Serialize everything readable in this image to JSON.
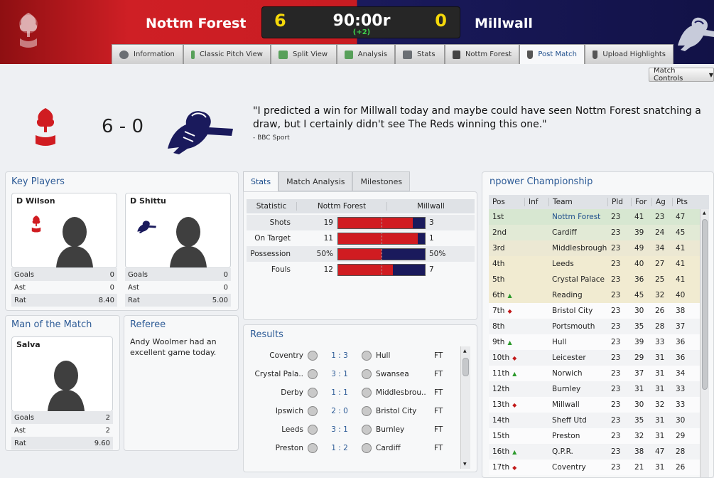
{
  "header": {
    "home_team": "Nottm Forest",
    "away_team": "Millwall",
    "home_score": "6",
    "away_score": "0",
    "clock": "90:00r",
    "added_time": "(+2)"
  },
  "tabs": [
    {
      "label": "Information",
      "icon": "info-icon"
    },
    {
      "label": "Classic Pitch View",
      "icon": "pitch-icon"
    },
    {
      "label": "Split View",
      "icon": "split-view-icon"
    },
    {
      "label": "Analysis",
      "icon": "analysis-icon"
    },
    {
      "label": "Stats",
      "icon": "stats-icon"
    },
    {
      "label": "Nottm Forest",
      "icon": "team-icon"
    },
    {
      "label": "Post Match",
      "icon": "shield-icon",
      "active": true
    },
    {
      "label": "Upload Highlights",
      "icon": "upload-icon"
    }
  ],
  "match_controls": "Match Controls",
  "summary": {
    "score": "6 - 0",
    "quote": "\"I predicted a win for Millwall today and maybe could have seen Nottm Forest snatching a draw, but I certainly didn't see The Reds winning this one.\"",
    "source": "- BBC Sport"
  },
  "key_players": {
    "title": "Key Players",
    "players": [
      {
        "name": "D Wilson",
        "goals": "0",
        "ast": "0",
        "rat": "8.40"
      },
      {
        "name": "D Shittu",
        "goals": "0",
        "ast": "0",
        "rat": "5.00"
      }
    ],
    "labels": {
      "goals": "Goals",
      "ast": "Ast",
      "rat": "Rat"
    }
  },
  "motm": {
    "title": "Man of the Match",
    "name": "Salva",
    "goals": "2",
    "ast": "2",
    "rat": "9.60"
  },
  "referee": {
    "title": "Referee",
    "text": "Andy Woolmer had an excellent game today."
  },
  "stats_tabs": [
    "Stats",
    "Match Analysis",
    "Milestones"
  ],
  "stats": {
    "headers": [
      "Statistic",
      "Nottm Forest",
      "Millwall"
    ],
    "rows": [
      {
        "label": "Shots",
        "home": "19",
        "away": "3",
        "share": 0.86
      },
      {
        "label": "On Target",
        "home": "11",
        "away": "1",
        "share": 0.92
      },
      {
        "label": "Possession",
        "home": "50%",
        "away": "50%",
        "share": 0.5
      },
      {
        "label": "Fouls",
        "home": "12",
        "away": "7",
        "share": 0.63
      }
    ]
  },
  "results": {
    "title": "Results",
    "rows": [
      {
        "home": "Coventry",
        "score": "1 : 3",
        "away": "Hull",
        "status": "FT"
      },
      {
        "home": "Crystal Pala..",
        "score": "3 : 1",
        "away": "Swansea",
        "status": "FT"
      },
      {
        "home": "Derby",
        "score": "1 : 1",
        "away": "Middlesbrou..",
        "status": "FT"
      },
      {
        "home": "Ipswich",
        "score": "2 : 0",
        "away": "Bristol City",
        "status": "FT"
      },
      {
        "home": "Leeds",
        "score": "3 : 1",
        "away": "Burnley",
        "status": "FT"
      },
      {
        "home": "Preston",
        "score": "1 : 2",
        "away": "Cardiff",
        "status": "FT"
      }
    ]
  },
  "league": {
    "title": "npower Championship",
    "headers": [
      "Pos",
      "Inf",
      "Team",
      "Pld",
      "For",
      "Ag",
      "Pts"
    ],
    "rows": [
      {
        "pos": "1st",
        "move": "",
        "team": "Nottm Forest",
        "pld": "23",
        "for": "41",
        "ag": "23",
        "pts": "47",
        "zone": "#d7e7d1",
        "highlight": true
      },
      {
        "pos": "2nd",
        "move": "",
        "team": "Cardiff",
        "pld": "23",
        "for": "39",
        "ag": "24",
        "pts": "45",
        "zone": "#e2ead6"
      },
      {
        "pos": "3rd",
        "move": "",
        "team": "Middlesbrough",
        "pld": "23",
        "for": "49",
        "ag": "34",
        "pts": "41",
        "zone": "#ece8d3"
      },
      {
        "pos": "4th",
        "move": "",
        "team": "Leeds",
        "pld": "23",
        "for": "40",
        "ag": "27",
        "pts": "41",
        "zone": "#f1ebd1"
      },
      {
        "pos": "5th",
        "move": "",
        "team": "Crystal Palace",
        "pld": "23",
        "for": "36",
        "ag": "25",
        "pts": "41",
        "zone": "#f1ebd1"
      },
      {
        "pos": "6th",
        "move": "up",
        "team": "Reading",
        "pld": "23",
        "for": "45",
        "ag": "32",
        "pts": "40",
        "zone": "#f1ebd1"
      },
      {
        "pos": "7th",
        "move": "down",
        "team": "Bristol City",
        "pld": "23",
        "for": "30",
        "ag": "26",
        "pts": "38",
        "zone": ""
      },
      {
        "pos": "8th",
        "move": "",
        "team": "Portsmouth",
        "pld": "23",
        "for": "35",
        "ag": "28",
        "pts": "37",
        "zone": ""
      },
      {
        "pos": "9th",
        "move": "up",
        "team": "Hull",
        "pld": "23",
        "for": "39",
        "ag": "33",
        "pts": "36",
        "zone": ""
      },
      {
        "pos": "10th",
        "move": "down",
        "team": "Leicester",
        "pld": "23",
        "for": "29",
        "ag": "31",
        "pts": "36",
        "zone": ""
      },
      {
        "pos": "11th",
        "move": "up",
        "team": "Norwich",
        "pld": "23",
        "for": "37",
        "ag": "31",
        "pts": "34",
        "zone": ""
      },
      {
        "pos": "12th",
        "move": "",
        "team": "Burnley",
        "pld": "23",
        "for": "31",
        "ag": "31",
        "pts": "33",
        "zone": ""
      },
      {
        "pos": "13th",
        "move": "down",
        "team": "Millwall",
        "pld": "23",
        "for": "30",
        "ag": "32",
        "pts": "33",
        "zone": ""
      },
      {
        "pos": "14th",
        "move": "",
        "team": "Sheff Utd",
        "pld": "23",
        "for": "35",
        "ag": "31",
        "pts": "30",
        "zone": ""
      },
      {
        "pos": "15th",
        "move": "",
        "team": "Preston",
        "pld": "23",
        "for": "32",
        "ag": "31",
        "pts": "29",
        "zone": ""
      },
      {
        "pos": "16th",
        "move": "up",
        "team": "Q.P.R.",
        "pld": "23",
        "for": "38",
        "ag": "47",
        "pts": "28",
        "zone": ""
      },
      {
        "pos": "17th",
        "move": "down",
        "team": "Coventry",
        "pld": "23",
        "for": "21",
        "ag": "31",
        "pts": "26",
        "zone": ""
      }
    ]
  },
  "colors": {
    "home": "#d01c21",
    "away": "#1a1a5c",
    "accent": "#2d5b96"
  }
}
